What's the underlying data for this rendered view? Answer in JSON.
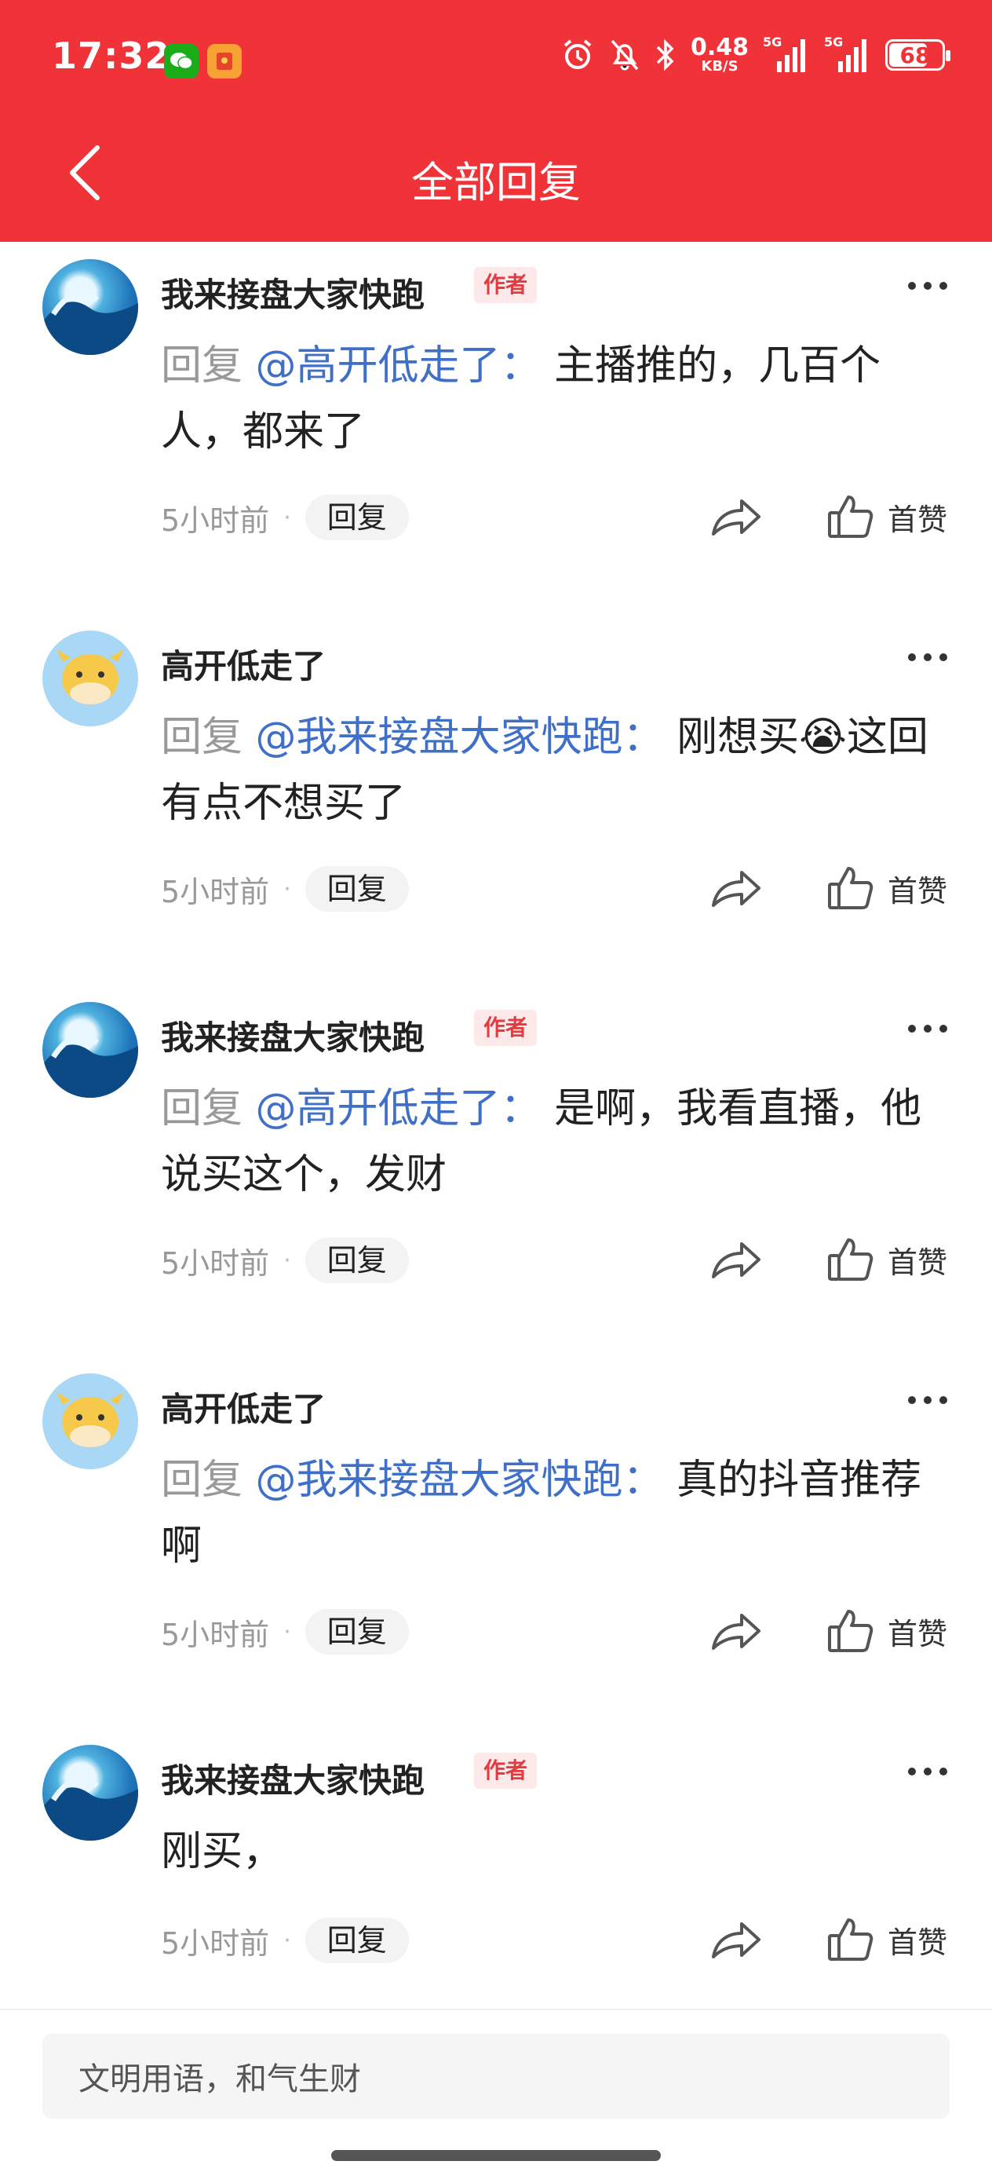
{
  "status_bar": {
    "time": "17:32",
    "net_speed_value": "0.48",
    "net_speed_unit": "KB/S",
    "signal1_label": "5G",
    "signal2_label": "5G",
    "battery": "68"
  },
  "header": {
    "title": "全部回复"
  },
  "comments": [
    {
      "username": "我来接盘大家快跑",
      "badge": "作者",
      "avatar": "wave",
      "reply_label": "回复",
      "mention": "@高开低走了：",
      "text": "主播推的，几百个人，都来了",
      "time": "5小时前",
      "reply_button": "回复",
      "like_label": "首赞"
    },
    {
      "username": "高开低走了",
      "badge": "",
      "avatar": "cow",
      "reply_label": "回复",
      "mention": "@我来接盘大家快跑：",
      "text_before_emoji": "刚想买",
      "emoji": "😭",
      "text": "这回有点不想买了",
      "time": "5小时前",
      "reply_button": "回复",
      "like_label": "首赞"
    },
    {
      "username": "我来接盘大家快跑",
      "badge": "作者",
      "avatar": "wave",
      "reply_label": "回复",
      "mention": "@高开低走了：",
      "text": "是啊，我看直播，他说买这个，发财",
      "time": "5小时前",
      "reply_button": "回复",
      "like_label": "首赞"
    },
    {
      "username": "高开低走了",
      "badge": "",
      "avatar": "cow",
      "reply_label": "回复",
      "mention": "@我来接盘大家快跑：",
      "text": "真的抖音推荐啊",
      "time": "5小时前",
      "reply_button": "回复",
      "like_label": "首赞"
    },
    {
      "username": "我来接盘大家快跑",
      "badge": "作者",
      "avatar": "wave",
      "text": "刚买，",
      "time": "5小时前",
      "reply_button": "回复",
      "like_label": "首赞"
    }
  ],
  "input": {
    "placeholder": "文明用语，和气生财"
  },
  "colors": {
    "brand_red": "#f03338",
    "mention_blue": "#3f6fc7",
    "badge_red": "#e33b40"
  },
  "icons": [
    "back-icon",
    "share-icon",
    "thumb-up-icon",
    "more-icon",
    "alarm-icon",
    "mute-icon",
    "bluetooth-icon",
    "wechat-icon",
    "red-packet-icon"
  ]
}
